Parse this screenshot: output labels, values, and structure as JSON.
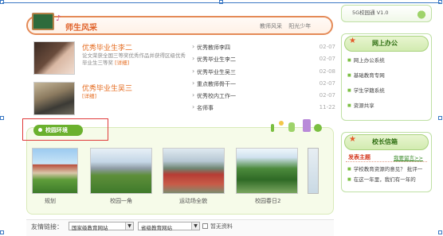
{
  "section": {
    "title": "师生风采",
    "links": [
      "教师风采",
      "阳光少年"
    ]
  },
  "students": [
    {
      "name": "优秀毕业生李二",
      "desc": "论文荣获全国三等奖优秀作品并获得区级优秀毕业生三等奖",
      "detail": "[详细]"
    },
    {
      "name": "优秀毕业生吴三",
      "desc": "",
      "detail": "[详细]"
    }
  ],
  "news": [
    {
      "title": "优秀教师李四",
      "date": "02-07"
    },
    {
      "title": "优秀毕业生李二",
      "date": "02-07"
    },
    {
      "title": "优秀毕业生吴三",
      "date": "02-08"
    },
    {
      "title": "重点教师骨干一",
      "date": "02-07"
    },
    {
      "title": "优秀校内工作一",
      "date": "02-07"
    },
    {
      "title": "名师事",
      "date": "11-22"
    }
  ],
  "campus": {
    "tab_label": "校园环境",
    "gallery": [
      {
        "caption": "规划"
      },
      {
        "caption": "校园一角"
      },
      {
        "caption": "运动场全貌"
      },
      {
        "caption": "校园春日2"
      }
    ]
  },
  "sidebar": {
    "top_text": "5G校园通  V1.0",
    "office": {
      "title": "网上办公",
      "items": [
        "网上办公系统",
        "基础教育专网",
        "学生学籍系统",
        "资源共享"
      ]
    },
    "mailbox": {
      "title": "校长信箱",
      "tabs": [
        "发表主题",
        "我要留言>>"
      ],
      "items": [
        "学校教育资源的意见？ 批评一",
        "在这一年里，我们有一年的"
      ]
    }
  },
  "friend_links": {
    "label": "友情链接：",
    "select1": "国家级教育网站",
    "select2": "省级教育网站",
    "nodata": "暂无资料"
  }
}
